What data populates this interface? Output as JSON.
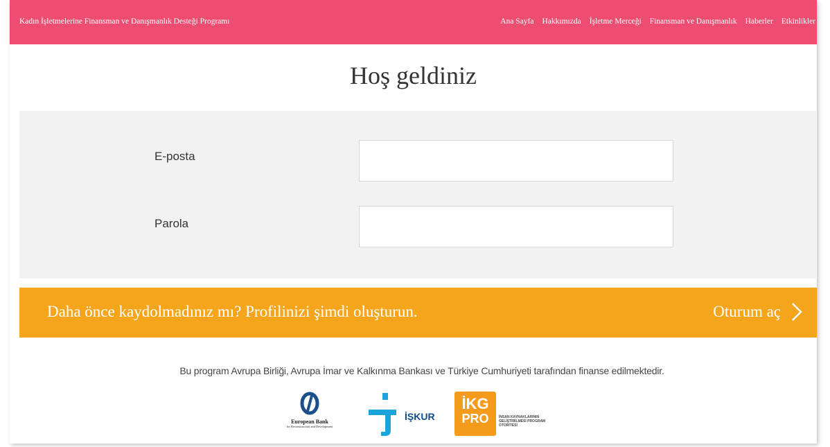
{
  "header": {
    "brand": "Kadın İşletmelerine Finansman ve Danışmanlık Desteği Programı",
    "nav": [
      "Ana Sayfa",
      "Hakkımızda",
      "İşletme Merceği",
      "Finansman ve Danışmanlık",
      "Haberler",
      "Etkinlikler"
    ]
  },
  "main": {
    "title": "Hoş geldiniz",
    "email_label": "E-posta",
    "email_value": "",
    "password_label": "Parola",
    "password_value": ""
  },
  "cta": {
    "register_text": "Daha önce kaydolmadınız mı? Profilinizi şimdi oluşturun.",
    "login_label": "Oturum aç"
  },
  "footer": {
    "funding_text": "Bu program Avrupa Birliği, Avrupa İmar ve Kalkınma Bankası ve Türkiye Cumhuriyeti tarafından finanse edilmektedir.",
    "logos": {
      "ebrd_line1": "European Bank",
      "ebrd_line2": "for Reconstruction and Development",
      "iskur": "İŞKUR",
      "ikg_top": "İKG",
      "ikg_bottom": "PRO",
      "ikg_desc": "İNSAN KAYNAKLARININ GELİŞTİRİLMESİ PROGRAM OTORİTESİ"
    }
  },
  "colors": {
    "header_bg": "#ee4d72",
    "cta_bg": "#f5a51b",
    "panel_bg": "#f2f2f2"
  }
}
